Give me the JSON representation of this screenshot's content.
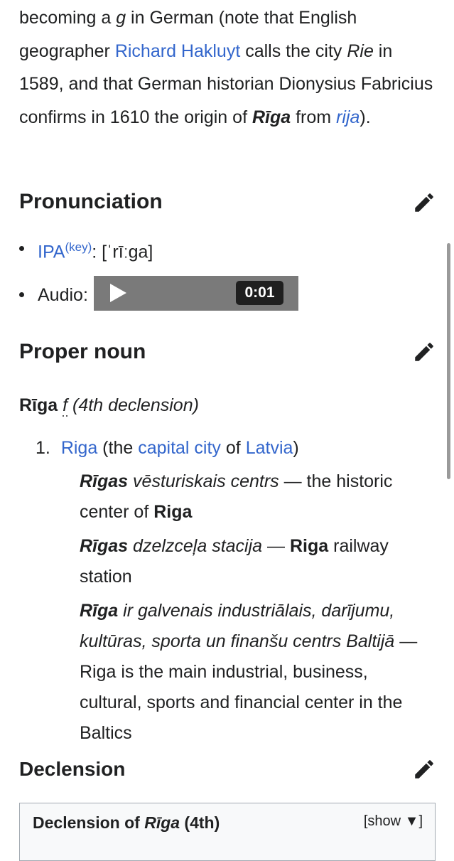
{
  "etymology": {
    "t1": "becoming a ",
    "g": "g",
    "t2": " in German (note that English geographer ",
    "hakluyt_link": "Richard Hakluyt",
    "t3": " calls the city ",
    "rie": "Rie",
    "t4": " in 1589, and that German historian Dionysius Fabricius confirms in 1610 the origin of ",
    "riga_bold": "Rīga",
    "t5": " from ",
    "rija_link": "rija",
    "t6": ")."
  },
  "pronunciation": {
    "heading": "Pronunciation",
    "ipa_link": "IPA",
    "ipa_key": "(key)",
    "ipa_colon": ":",
    "ipa_value": " [ˈrīːɡa]",
    "audio_label": "Audio:",
    "audio_time": "0:01"
  },
  "proper_noun": {
    "heading": "Proper noun",
    "headword": "Rīga",
    "gender": "f",
    "declension_note": " (4th declension)",
    "sense": {
      "number": "1.",
      "link_riga": "Riga",
      "text_the": " (the ",
      "link_capital": "capital city",
      "text_of": " of ",
      "link_latvia": "Latvia",
      "text_close": ")"
    },
    "examples": [
      {
        "b": "Rīgas",
        "i": " vēsturiskais centrs",
        "t1": " — the historic center of ",
        "b2": "Riga",
        "t2": ""
      },
      {
        "b": "Rīgas",
        "i": " dzelzceļa stacija",
        "t1": " — ",
        "b2": "Riga",
        "t2": " railway station"
      },
      {
        "b": "Rīga",
        "i": " ir galvenais industriālais, darījumu, kultūras, sporta un finanšu centrs Baltijā",
        "t1": " — Riga is the main industrial, business, cultural, sports and financial center in the Baltics",
        "b2": "",
        "t2": ""
      }
    ]
  },
  "declension": {
    "heading": "Declension",
    "table_title_prefix": "Declension of ",
    "table_title_word": "Rīga",
    "table_title_suffix": " (4th)",
    "toggle": "[show ▼]"
  },
  "icons": [
    "edit-pencil-icon",
    "play-icon"
  ],
  "colors": {
    "link": "#3366cc",
    "player": "#7a7a7a",
    "badge": "#1f1f1f"
  }
}
